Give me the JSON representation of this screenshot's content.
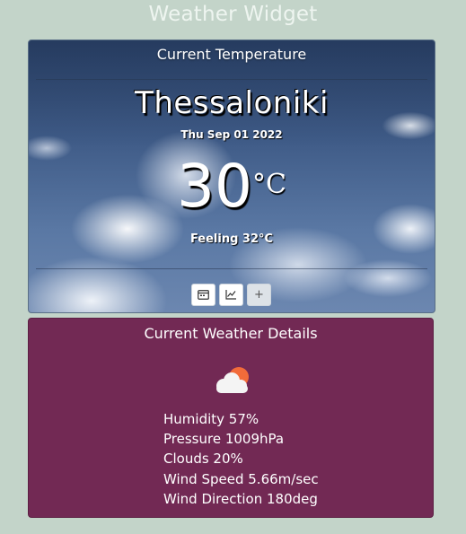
{
  "app": {
    "title": "Weather Widget"
  },
  "current": {
    "heading": "Current Temperature",
    "city": "Thessaloniki",
    "date": "Thu Sep 01 2022",
    "temperature": "30",
    "unit": "°C",
    "feeling": "Feeling 32°C"
  },
  "toolbar": {
    "calendar_icon": "calendar-icon",
    "chart_icon": "line-chart-icon",
    "plus_label": "+"
  },
  "details": {
    "heading": "Current Weather Details",
    "icon": "partly-cloudy-icon",
    "humidity": "Humidity 57%",
    "pressure": "Pressure 1009hPa",
    "clouds": "Clouds 20%",
    "wind_speed": "Wind Speed 5.66m/sec",
    "wind_direction": "Wind Direction 180deg"
  },
  "colors": {
    "page_background": "#c3d4c9",
    "details_background": "#722954",
    "sun": "#f26b3a"
  }
}
